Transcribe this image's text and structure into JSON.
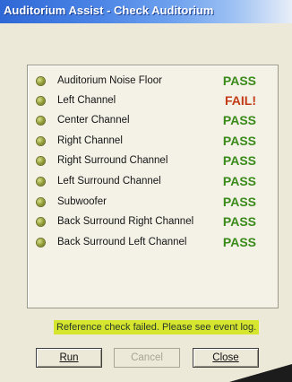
{
  "window": {
    "title": "Auditorium Assist - Check Auditorium"
  },
  "checks": [
    {
      "label": "Auditorium Noise Floor",
      "result": "PASS"
    },
    {
      "label": "Left Channel",
      "result": "FAIL!"
    },
    {
      "label": "Center Channel",
      "result": "PASS"
    },
    {
      "label": "Right Channel",
      "result": "PASS"
    },
    {
      "label": "Right Surround Channel",
      "result": "PASS"
    },
    {
      "label": "Left Surround Channel",
      "result": "PASS"
    },
    {
      "label": "Subwoofer",
      "result": "PASS"
    },
    {
      "label": "Back Surround Right Channel",
      "result": "PASS"
    },
    {
      "label": "Back Surround Left Channel",
      "result": "PASS"
    }
  ],
  "status": {
    "message": "Reference check failed. Please see event log.",
    "highlight_color": "#d6e62f"
  },
  "colors": {
    "pass": "#3a8a1a",
    "fail": "#c23b16"
  },
  "buttons": {
    "run_label": "Run",
    "cancel_label": "Cancel",
    "close_label": "Close"
  }
}
